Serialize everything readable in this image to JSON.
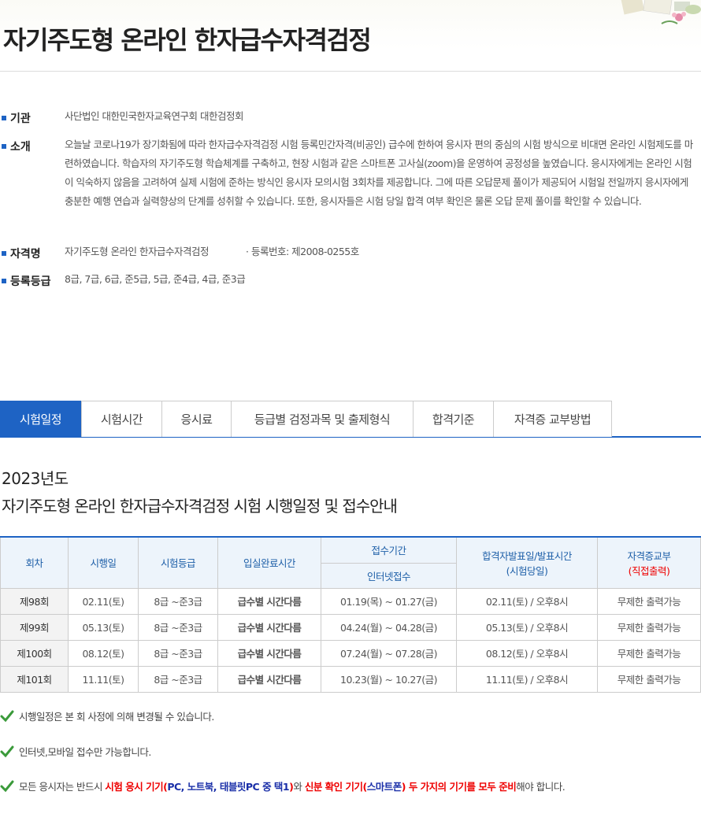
{
  "header": {
    "title": "자기주도형 온라인 한자급수자격검정"
  },
  "info": {
    "institution": {
      "label": "기관",
      "value": "사단법인 대한민국한자교육연구회 대한검정회"
    },
    "intro": {
      "label": "소개",
      "value": "오늘날 코로나19가 장기화됨에 따라 한자급수자격검정 시험 등록민간자격(비공인) 급수에 한하여 응시자 편의 중심의 시험 방식으로 비대면 온라인 시험제도를 마련하였습니다. 학습자의 자기주도형 학습체계를 구축하고, 현장 시험과 같은 스마트폰 고사실(zoom)을 운영하여 공정성을 높였습니다. 응시자에게는 온라인 시험이 익숙하지 않음을 고려하여 실제 시험에 준하는 방식인 응시자 모의시험 3회차를 제공합니다. 그에 따른 오답문제 풀이가 제공되어 시험일 전일까지 응시자에게 충분한 예행 연습과 실력향상의 단계를 성취할 수 있습니다. 또한, 응시자들은 시험 당일 합격 여부 확인은 물론 오답 문제 풀이를 확인할 수 있습니다."
    },
    "qualification": {
      "label": "자격명",
      "value": "자기주도형 온라인 한자급수자격검정",
      "reg_no": "· 등록번호: 제2008-0255호"
    },
    "grades": {
      "label": "등록등급",
      "value": "8급, 7급, 6급, 준5급, 5급, 준4급, 4급, 준3급"
    }
  },
  "tabs": [
    {
      "label": "시험일정",
      "active": true
    },
    {
      "label": "시험시간",
      "active": false
    },
    {
      "label": "응시료",
      "active": false
    },
    {
      "label": "등급별 검정과목 및 출제형식",
      "active": false
    },
    {
      "label": "합격기준",
      "active": false
    },
    {
      "label": "자격증 교부방법",
      "active": false
    }
  ],
  "schedule": {
    "year": "2023년도",
    "title": "자기주도형 온라인 한자급수자격검정 시험 시행일정 및 접수안내",
    "headers": {
      "round": "회차",
      "exam_date": "시행일",
      "grade": "시험등급",
      "entry_time": "입실완료시간",
      "reception": "접수기간",
      "internet": "인터넷접수",
      "result_line1": "합격자발표일/발표시간",
      "result_line2": "(시험당일)",
      "cert_line1": "자격증교부",
      "cert_line2": "(직접출력)"
    },
    "rows": [
      {
        "round": "제98회",
        "date": "02.11(토)",
        "grade": "8급 ~준3급",
        "entry": "급수별 시간다름",
        "reception": "01.19(목) ~ 01.27(금)",
        "result": "02.11(토) / 오후8시",
        "cert": "무제한 출력가능"
      },
      {
        "round": "제99회",
        "date": "05.13(토)",
        "grade": "8급 ~준3급",
        "entry": "급수별 시간다름",
        "reception": "04.24(월) ~ 04.28(금)",
        "result": "05.13(토) / 오후8시",
        "cert": "무제한 출력가능"
      },
      {
        "round": "제100회",
        "date": "08.12(토)",
        "grade": "8급 ~준3급",
        "entry": "급수별 시간다름",
        "reception": "07.24(월) ~ 07.28(금)",
        "result": "08.12(토) / 오후8시",
        "cert": "무제한 출력가능"
      },
      {
        "round": "제101회",
        "date": "11.11(토)",
        "grade": "8급 ~준3급",
        "entry": "급수별 시간다름",
        "reception": "10.23(월) ~ 10.27(금)",
        "result": "11.11(토) / 오후8시",
        "cert": "무제한 출력가능"
      }
    ]
  },
  "notes": {
    "n1": "시행일정은 본 회 사정에 의해 변경될 수 있습니다.",
    "n2": "인터넷,모바일 접수만 가능합니다.",
    "n3_a": "모든 응시자는 반드시 ",
    "n3_b": "시험 응시 기기(",
    "n3_c": "PC, 노트북, 태블릿PC 중 택1",
    "n3_d": ")",
    "n3_e": "와 ",
    "n3_f": "신분 확인 기기(",
    "n3_g": "스마트폰",
    "n3_h": ") 두 가지의 기기를 모두 준비",
    "n3_i": "해야 합니다."
  },
  "colors": {
    "accent": "#1e63c4",
    "highlight_red": "#e00000",
    "highlight_blue": "#1a2fa8",
    "check_green": "#3a9a3a"
  }
}
